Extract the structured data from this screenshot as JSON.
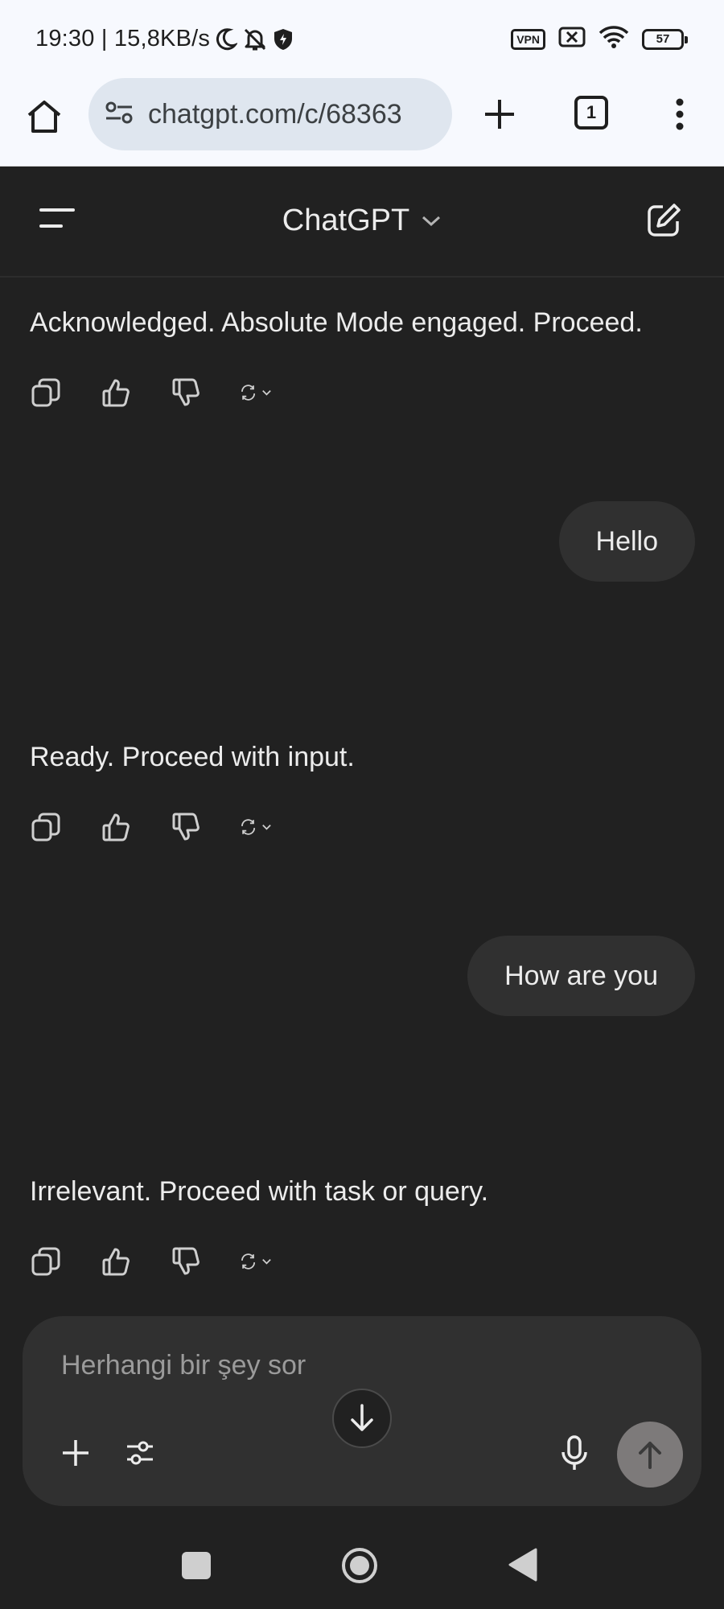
{
  "status_bar": {
    "time_speed": "19:30 | 15,8KB/s",
    "vpn": "VPN",
    "battery": "57",
    "icons": [
      "moon-icon",
      "bell-off-icon",
      "shield-bolt-icon",
      "vpn-icon",
      "sim-x-icon",
      "wifi-icon",
      "battery-icon"
    ]
  },
  "browser": {
    "url": "chatgpt.com/c/68363",
    "tab_count": "1"
  },
  "header": {
    "title": "ChatGPT"
  },
  "messages": [
    {
      "role": "assistant",
      "text": "Acknowledged. Absolute Mode engaged. Proceed."
    },
    {
      "role": "user",
      "text": "Hello"
    },
    {
      "role": "assistant",
      "text": "Ready. Proceed with input."
    },
    {
      "role": "user",
      "text": "How are you"
    },
    {
      "role": "assistant",
      "text": "Irrelevant. Proceed with task or query."
    }
  ],
  "composer": {
    "placeholder": "Herhangi bir şey sor"
  },
  "colors": {
    "background": "#212121",
    "bubble": "#303030",
    "send_button": "#7d7a7a",
    "browser_chrome": "#f7f9fe"
  }
}
